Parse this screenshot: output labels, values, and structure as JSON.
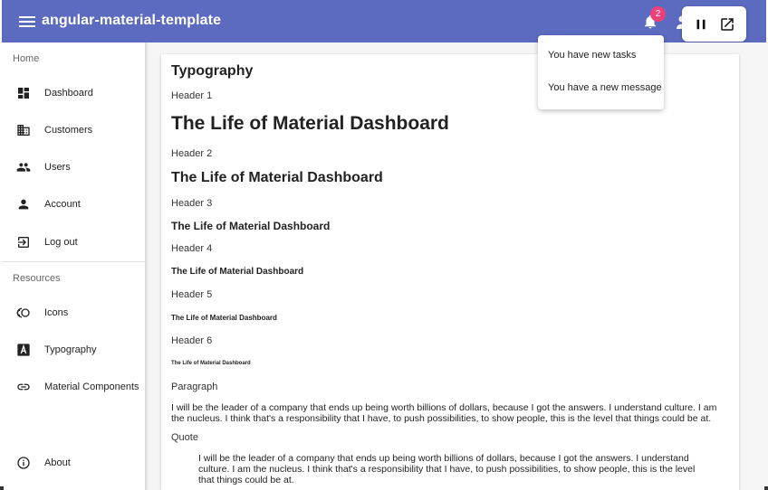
{
  "header": {
    "title": "angular-material-template",
    "notification_count": "2"
  },
  "notifications": [
    {
      "label": "You have new tasks"
    },
    {
      "label": "You have a new message"
    }
  ],
  "sidebar": {
    "section_home": "Home",
    "section_resources": "Resources",
    "items": [
      {
        "label": "Dashboard",
        "icon": "dashboard-icon"
      },
      {
        "label": "Customers",
        "icon": "building-icon"
      },
      {
        "label": "Users",
        "icon": "people-icon"
      },
      {
        "label": "Account",
        "icon": "person-icon"
      },
      {
        "label": "Log out",
        "icon": "logout-icon"
      },
      {
        "label": "Icons",
        "icon": "icons-icon"
      },
      {
        "label": "Typography",
        "icon": "typography-icon"
      },
      {
        "label": "Material Components",
        "icon": "link-icon"
      },
      {
        "label": "About",
        "icon": "info-icon"
      }
    ]
  },
  "typography": {
    "title": "Typography",
    "h1_label": "Header 1",
    "h1_text": "The Life of Material Dashboard",
    "h2_label": "Header 2",
    "h2_text": "The Life of Material Dashboard",
    "h3_label": "Header 3",
    "h3_text": "The Life of Material Dashboard",
    "h4_label": "Header 4",
    "h4_text": "The Life of Material Dashboard",
    "h5_label": "Header 5",
    "h5_text": "The Life of Material Dashboard",
    "h6_label": "Header 6",
    "h6_text": "The Life of Material Dashboard",
    "paragraph_label": "Paragraph",
    "paragraph_text": "I will be the leader of a company that ends up being worth billions of dollars, because I got the answers. I understand culture. I am the nucleus. I think that's a responsibility that I have, to push possibilities, to show people, this is the level that things could be at.",
    "quote_label": "Quote",
    "quote_text": "I will be the leader of a company that ends up being worth billions of dollars, because I got the answers. I understand culture. I am the nucleus. I think that's a responsibility that I have, to push possibilities, to show people, this is the level that things could be at."
  },
  "colors": {
    "toolbar": "#5c6bc0",
    "badge": "#ec407a"
  }
}
